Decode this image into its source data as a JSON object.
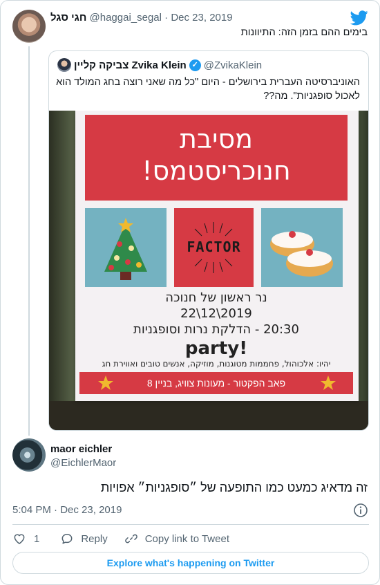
{
  "colors": {
    "accent": "#1d9bf0",
    "text_primary": "#0f1419",
    "text_secondary": "#536471",
    "border": "#cfd9de",
    "poster_red": "#d63a44",
    "poster_teal": "#74b2c1"
  },
  "parent_tweet": {
    "name": "חגי סגל",
    "handle": "@haggai_segal",
    "separator": "·",
    "date": "Dec 23, 2019",
    "text": "בימים ההם בזמן הזה: התיוונות"
  },
  "quoted_tweet": {
    "name": "צביקה קליין Zvika Klein",
    "verified_icon": "verified-badge-icon",
    "handle": "@ZvikaKlein",
    "text": "האוניברסיטה העברית בירושלים - היום \"כל מה שאני רוצה בחג המולד הוא לאכול סופגניות\". מה??",
    "poster": {
      "title_line1": "מסיבת",
      "title_line2": "חנוכריסטמס!",
      "factor_word": "FACTOR",
      "line1": "נר ראשון של חנוכה",
      "line2": "22\\12\\2019",
      "line3": "20:30 - הדלקת נרות וסופגניות",
      "party": "party!",
      "sub": "יהיו: אלכוהול, פחממות מטוגנות, מוזיקה, אנשים טובים ואווירת חג",
      "footer": "פאב הפקטור - מעונות צוויג, בניין 8"
    }
  },
  "main_tweet": {
    "name": "maor eichler",
    "handle": "@EichlerMaor",
    "text": "זה מדאיג כמעט כמו התופעה של ״סופגניות״ אפויות",
    "time": "5:04 PM",
    "separator": "·",
    "date": "Dec 23, 2019"
  },
  "actions": {
    "like_count": "1",
    "reply_label": "Reply",
    "copy_label": "Copy link to Tweet"
  },
  "explore_label": "Explore what's happening on Twitter"
}
